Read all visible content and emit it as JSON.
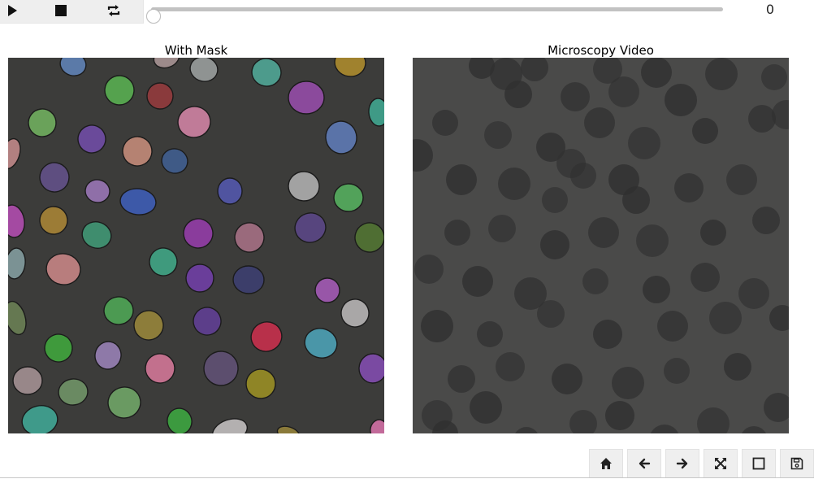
{
  "player": {
    "play_icon": "play-icon",
    "stop_icon": "stop-icon",
    "loop_icon": "repeat-icon",
    "slider": {
      "min": 0,
      "max": 100,
      "value": 0
    },
    "frame_value": "0"
  },
  "figure": {
    "left_title": "With Mask",
    "right_title": "Microscopy Video"
  },
  "toolbar": {
    "buttons": [
      "home-icon",
      "back-arrow-icon",
      "forward-arrow-icon",
      "pan-move-icon",
      "zoom-rectangle-icon",
      "save-icon"
    ]
  },
  "colors": {
    "mask_background": "#3c3c3a",
    "micro_background": "#4a4a49",
    "micro_cell": "#303030",
    "toolbar_bg": "#efefef",
    "player_bg": "#eeeeee"
  }
}
